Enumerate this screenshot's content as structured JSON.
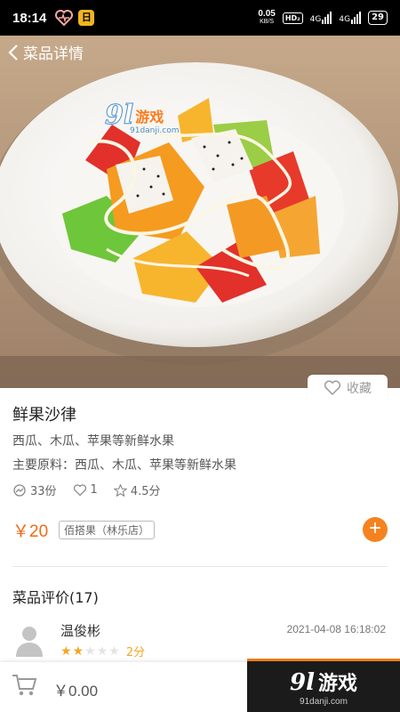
{
  "status_bar": {
    "time": "18:14",
    "app_badge": "日",
    "net_speed": "0.05",
    "net_unit": "KB/S",
    "hd_label": "HD₂",
    "signal_1": "4G",
    "signal_2": "4G",
    "battery": "29"
  },
  "nav": {
    "title": "菜品详情"
  },
  "watermark": {
    "num": "9l",
    "text": "游戏",
    "url": "91danji.com"
  },
  "favorite": {
    "label": "收藏"
  },
  "dish": {
    "name": "鲜果沙律",
    "description": "西瓜、木瓜、苹果等新鲜水果",
    "ingredients": "主要原料：西瓜、木瓜、苹果等新鲜水果",
    "sales": "33份",
    "likes": "1",
    "rating": "4.5分",
    "price": "￥20",
    "shop": "佰搭果（林乐店）"
  },
  "reviews": {
    "title": "菜品评价(17)",
    "items": [
      {
        "name": "温俊彬",
        "time": "2021-04-08 16:18:02",
        "score": "2分",
        "stars": 2
      }
    ]
  },
  "cart": {
    "total": "￥0.00"
  },
  "promo": {
    "num": "9l",
    "name": "游戏",
    "url": "91danji.com"
  },
  "colors": {
    "accent": "#f5821f",
    "price": "#f06a16",
    "star": "#f5a623"
  }
}
